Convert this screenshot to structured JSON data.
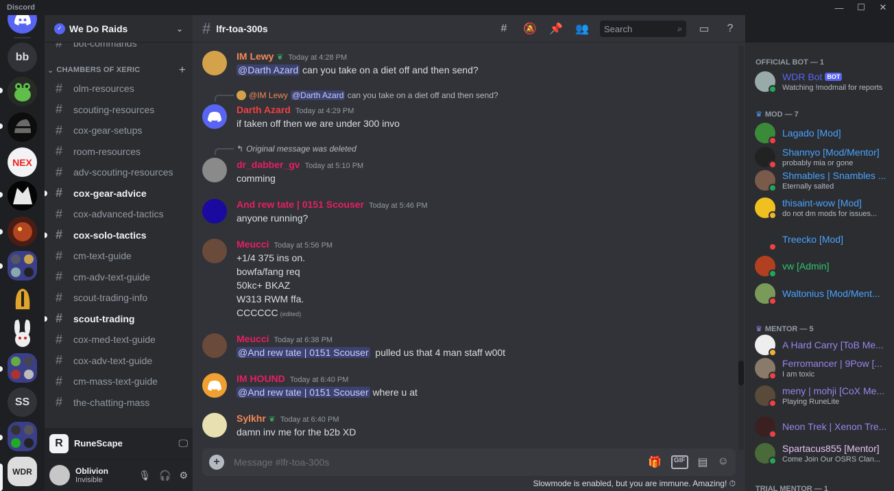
{
  "window": {
    "app_title": "Discord"
  },
  "guild": {
    "name": "We Do Raids"
  },
  "servers": {
    "bb": "bb",
    "nex": "NEX",
    "ss": "SS",
    "wdr": "WDR"
  },
  "channels": {
    "partial_top": "bot-commands",
    "category": "CHAMBERS OF XERIC",
    "items": [
      {
        "name": "olm-resources",
        "unread": false
      },
      {
        "name": "scouting-resources",
        "unread": false
      },
      {
        "name": "cox-gear-setups",
        "unread": false
      },
      {
        "name": "room-resources",
        "unread": false
      },
      {
        "name": "adv-scouting-resources",
        "unread": false
      },
      {
        "name": "cox-gear-advice",
        "unread": true
      },
      {
        "name": "cox-advanced-tactics",
        "unread": false
      },
      {
        "name": "cox-solo-tactics",
        "unread": true
      },
      {
        "name": "cm-text-guide",
        "unread": false
      },
      {
        "name": "cm-adv-text-guide",
        "unread": false
      },
      {
        "name": "scout-trading-info",
        "unread": false
      },
      {
        "name": "scout-trading",
        "unread": true
      },
      {
        "name": "cox-med-text-guide",
        "unread": false
      },
      {
        "name": "cox-adv-text-guide",
        "unread": false
      },
      {
        "name": "cm-mass-text-guide",
        "unread": false
      },
      {
        "name": "the-chatting-mass",
        "unread": false
      }
    ]
  },
  "activity": {
    "game": "RuneScape",
    "icon_letter": "R"
  },
  "user": {
    "name": "Oblivion",
    "status": "Invisible"
  },
  "chat": {
    "channel": "lfr-toa-300s",
    "search_placeholder": "Search",
    "composer_placeholder": "Message #lfr-toa-300s",
    "gif_label": "GIF",
    "slowmode": "Slowmode is enabled, but you are immune. Amazing!"
  },
  "messages": [
    {
      "author": "IM Lewy",
      "color": "#f48a57",
      "time": "Today at 4:28 PM",
      "mention": "@Darth Azard",
      "text": "can you take on a diet off and then send?"
    },
    {
      "reply_author": "@IM Lewy",
      "reply_mention": "@Darth Azard",
      "reply_text": "can you take on a diet off and then send?",
      "author": "Darth Azard",
      "color": "#f23f42",
      "time": "Today at 4:29 PM",
      "text": "if taken off then we are under 300 invo"
    },
    {
      "reply_deleted": "Original message was deleted",
      "author": "dr_dabber_gv",
      "color": "#e91e63",
      "time": "Today at 5:10 PM",
      "text": "comming"
    },
    {
      "author": "And rew tate | 0151 Scouser",
      "color": "#e91e63",
      "time": "Today at 5:46 PM",
      "text": "anyone running?"
    },
    {
      "author": "Meucci",
      "color": "#e91e63",
      "time": "Today at 5:56 PM",
      "lines": [
        "+1/4 375 ins on.",
        "bowfa/fang req",
        "50kc+ BKAZ",
        "W313 RWM ffa.",
        "CCCCCC"
      ],
      "edited": "(edited)"
    },
    {
      "author": "Meucci",
      "color": "#e91e63",
      "time": "Today at 6:38 PM",
      "mention": "@And rew tate | 0151 Scouser",
      "text": "pulled us that 4 man staff w00t"
    },
    {
      "author": "IM HOUND",
      "color": "#e91e63",
      "time": "Today at 6:40 PM",
      "mention": "@And rew tate | 0151 Scouser",
      "text": "where u at"
    },
    {
      "author": "Sylkhr",
      "color": "#f48a57",
      "time": "Today at 6:40 PM",
      "text": "damn inv me for the b2b XD"
    }
  ],
  "members": {
    "official_bot": "OFFICIAL BOT — 1",
    "mod": "MOD — 7",
    "mentor": "MENTOR — 5",
    "trial": "TRIAL MENTOR — 1",
    "bot_tag": "BOT",
    "list": [
      {
        "name": "WDR Bot",
        "activity": "Watching !modmail for reports",
        "color": "#5865f2",
        "status": "#23a55a"
      },
      {
        "name": "Lagado [Mod]",
        "activity": "",
        "color": "#4aa3ff",
        "status": "#f23f43"
      },
      {
        "name": "Shannyo [Mod/Mentor]",
        "activity": "probably mia or gone",
        "color": "#4aa3ff",
        "status": "#f23f43"
      },
      {
        "name": "Shmables | Snambles ...",
        "activity": "Eternally salted",
        "color": "#4aa3ff",
        "status": "#23a55a"
      },
      {
        "name": "thisaint-wow [Mod]",
        "activity": "do not dm mods for issues...",
        "color": "#4aa3ff",
        "status": "#f0b232"
      },
      {
        "name": "Treecko [Mod]",
        "activity": "",
        "color": "#4aa3ff",
        "status": "#f23f43"
      },
      {
        "name": "vw [Admin]",
        "activity": "",
        "color": "#2dc770",
        "status": "#23a55a"
      },
      {
        "name": "Waltonius [Mod/Ment...",
        "activity": "",
        "color": "#4aa3ff",
        "status": "#f23f43"
      },
      {
        "name": "A Hard Carry [ToB Me...",
        "activity": "",
        "color": "#9b84ec",
        "status": "#f0b232"
      },
      {
        "name": "Ferromancer | 9Pow [...",
        "activity": "I am toxic",
        "color": "#9b84ec",
        "status": "#f23f43"
      },
      {
        "name": "meny | mohji [CoX Me...",
        "activity": "Playing RuneLite",
        "color": "#9b84ec",
        "status": "#f23f43"
      },
      {
        "name": "Neon Trek | Xenon Tre...",
        "activity": "",
        "color": "#9b84ec",
        "status": "#f23f43"
      },
      {
        "name": "Spartacus855 [Mentor]",
        "activity": "Come Join Our OSRS Clan...",
        "color": "#e8c3f5",
        "status": "#23a55a"
      }
    ]
  }
}
